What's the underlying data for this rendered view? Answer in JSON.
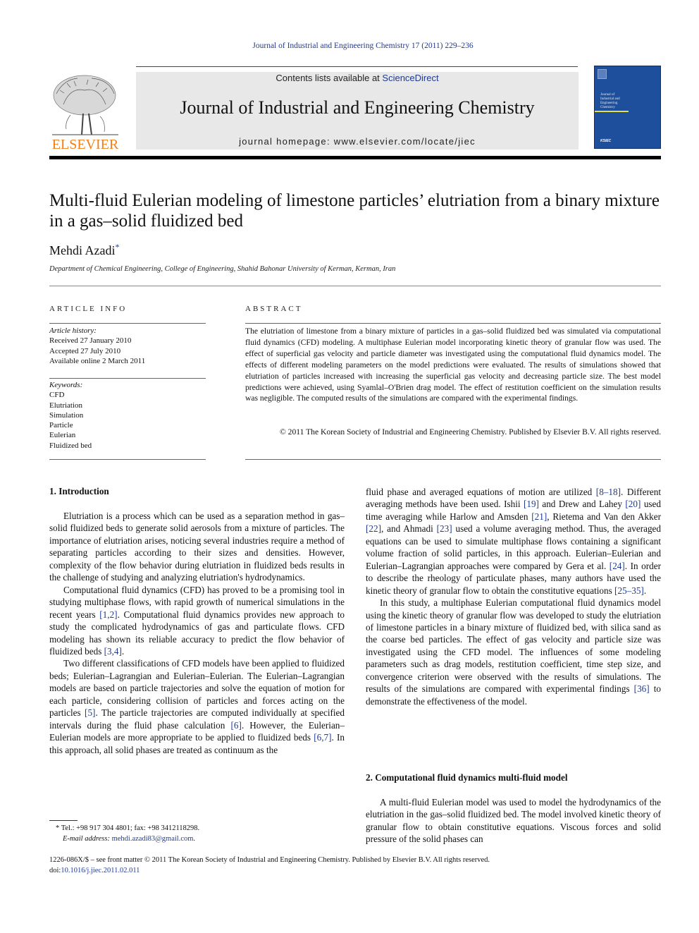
{
  "header": {
    "citation": "Journal of Industrial and Engineering Chemistry 17 (2011) 229–236",
    "contents_prefix": "Contents lists available at ",
    "contents_link": "ScienceDirect",
    "journal_name": "Journal of Industrial and Engineering Chemistry",
    "homepage": "journal homepage: www.elsevier.com/locate/jiec",
    "publisher_logo_text": "ELSEVIER",
    "cover": {
      "title_lines": [
        "Journal of",
        "Industrial and",
        "Engineering",
        "Chemistry"
      ],
      "society_mark": "KSIEC",
      "bg_color": "#1e4f9c",
      "accent_color": "#e6e03a"
    }
  },
  "article": {
    "title": "Multi-fluid Eulerian modeling of limestone particles’ elutriation from a binary mixture in a gas–solid fluidized bed",
    "author": "Mehdi Azadi",
    "author_mark": "*",
    "affiliation": "Department of Chemical Engineering, College of Engineering, Shahid Bahonar University of Kerman, Kerman, Iran"
  },
  "article_info": {
    "heading": "ARTICLE INFO",
    "history_label": "Article history:",
    "history": [
      "Received 27 January 2010",
      "Accepted 27 July 2010",
      "Available online 2 March 2011"
    ],
    "keywords_label": "Keywords:",
    "keywords": [
      "CFD",
      "Elutriation",
      "Simulation",
      "Particle",
      "Eulerian",
      "Fluidized bed"
    ]
  },
  "abstract": {
    "heading": "ABSTRACT",
    "text": "The elutriation of limestone from a binary mixture of particles in a gas–solid fluidized bed was simulated via computational fluid dynamics (CFD) modeling. A multiphase Eulerian model incorporating kinetic theory of granular flow was used. The effect of superficial gas velocity and particle diameter was investigated using the computational fluid dynamics model. The effects of different modeling parameters on the model predictions were evaluated. The results of simulations showed that elutriation of particles increased with increasing the superficial gas velocity and decreasing particle size. The best model predictions were achieved, using Syamlal–O'Brien drag model. The effect of restitution coefficient on the simulation results was negligible. The computed results of the simulations are compared with the experimental findings.",
    "copyright": "© 2011 The Korean Society of Industrial and Engineering Chemistry. Published by Elsevier B.V. All rights reserved."
  },
  "body": {
    "section1_heading": "1.  Introduction",
    "section1_paragraphs": [
      {
        "segments": [
          {
            "t": "Elutriation is a process which can be used as a separation method in gas–solid fluidized beds to generate solid aerosols from a mixture of particles. The importance of elutriation arises, noticing several industries require a method of separating particles according to their sizes and densities. However, complexity of the flow behavior during elutriation in fluidized beds results in the challenge of studying and analyzing elutriation's hydrodynamics."
          }
        ]
      },
      {
        "segments": [
          {
            "t": "Computational fluid dynamics (CFD) has proved to be a promising tool in studying multiphase flows, with rapid growth of numerical simulations in the recent years "
          },
          {
            "t": "[1,2]",
            "ref": true
          },
          {
            "t": ". Computational fluid dynamics provides new approach to study the complicated hydrodynamics of gas and particulate flows. CFD modeling has shown its reliable accuracy to predict the flow behavior of fluidized beds "
          },
          {
            "t": "[3,4]",
            "ref": true
          },
          {
            "t": "."
          }
        ]
      },
      {
        "segments": [
          {
            "t": "Two different classifications of CFD models have been applied to fluidized beds; Eulerian–Lagrangian and Eulerian–Eulerian. The Eulerian–Lagrangian models are based on particle trajectories and solve the equation of motion for each particle, considering collision of particles and forces acting on the particles "
          },
          {
            "t": "[5]",
            "ref": true
          },
          {
            "t": ". The particle trajectories are computed individually at specified intervals during the fluid phase calculation "
          },
          {
            "t": "[6]",
            "ref": true
          },
          {
            "t": ". However, the Eulerian–Eulerian models are more appropriate to be applied to fluidized beds "
          },
          {
            "t": "[6,7]",
            "ref": true
          },
          {
            "t": ". In this approach, all solid phases are treated as continuum as the"
          }
        ]
      }
    ],
    "column2_paragraphs": [
      {
        "noindent": true,
        "segments": [
          {
            "t": "fluid phase and averaged equations of motion are utilized "
          },
          {
            "t": "[8–18]",
            "ref": true
          },
          {
            "t": ". Different averaging methods have been used. Ishii "
          },
          {
            "t": "[19]",
            "ref": true
          },
          {
            "t": " and Drew and Lahey "
          },
          {
            "t": "[20]",
            "ref": true
          },
          {
            "t": " used time averaging while Harlow and Amsden "
          },
          {
            "t": "[21]",
            "ref": true
          },
          {
            "t": ", Rietema and Van den Akker "
          },
          {
            "t": "[22]",
            "ref": true
          },
          {
            "t": ", and Ahmadi "
          },
          {
            "t": "[23]",
            "ref": true
          },
          {
            "t": " used a volume averaging method. Thus, the averaged equations can be used to simulate multiphase flows containing a significant volume fraction of solid particles, in this approach. Eulerian–Eulerian and Eulerian–Lagrangian approaches were compared by Gera et al. "
          },
          {
            "t": "[24]",
            "ref": true
          },
          {
            "t": ". In order to describe the rheology of particulate phases, many authors have used the kinetic theory of granular flow to obtain the constitutive equations "
          },
          {
            "t": "[25–35]",
            "ref": true
          },
          {
            "t": "."
          }
        ]
      },
      {
        "segments": [
          {
            "t": "In this study, a multiphase Eulerian computational fluid dynamics model using the kinetic theory of granular flow was developed to study the elutriation of limestone particles in a binary mixture of fluidized bed, with silica sand as the coarse bed particles. The effect of gas velocity and particle size was investigated using the CFD model. The influences of some modeling parameters such as drag models, restitution coefficient, time step size, and convergence criterion were observed with the results of simulations. The results of the simulations are compared with experimental findings "
          },
          {
            "t": "[36]",
            "ref": true
          },
          {
            "t": " to demonstrate the effectiveness of the model."
          }
        ]
      }
    ],
    "section2_heading": "2.  Computational fluid dynamics multi-fluid model",
    "section2_paragraphs": [
      {
        "segments": [
          {
            "t": "A multi-fluid Eulerian model was used to model the hydrodynamics of the elutriation in the gas–solid fluidized bed. The model involved kinetic theory of granular flow to obtain constitutive equations. Viscous forces and solid pressure of the solid phases can"
          }
        ]
      }
    ]
  },
  "footnote": {
    "mark": "*",
    "contact": "Tel.: +98 917 304 4801; fax: +98 3412118298.",
    "email_label": "E-mail address:",
    "email": "mehdi.azadi83@gmail.com",
    "email_suffix": "."
  },
  "front_matter": {
    "line": "1226-086X/$ – see front matter © 2011 The Korean Society of Industrial and Engineering Chemistry. Published by Elsevier B.V. All rights reserved.",
    "doi_label": "doi:",
    "doi": "10.1016/j.jiec.2011.02.011"
  },
  "colors": {
    "link": "#1f3a93",
    "elsevier_orange": "#f07f1b",
    "header_gray": "#e8e8e8"
  }
}
